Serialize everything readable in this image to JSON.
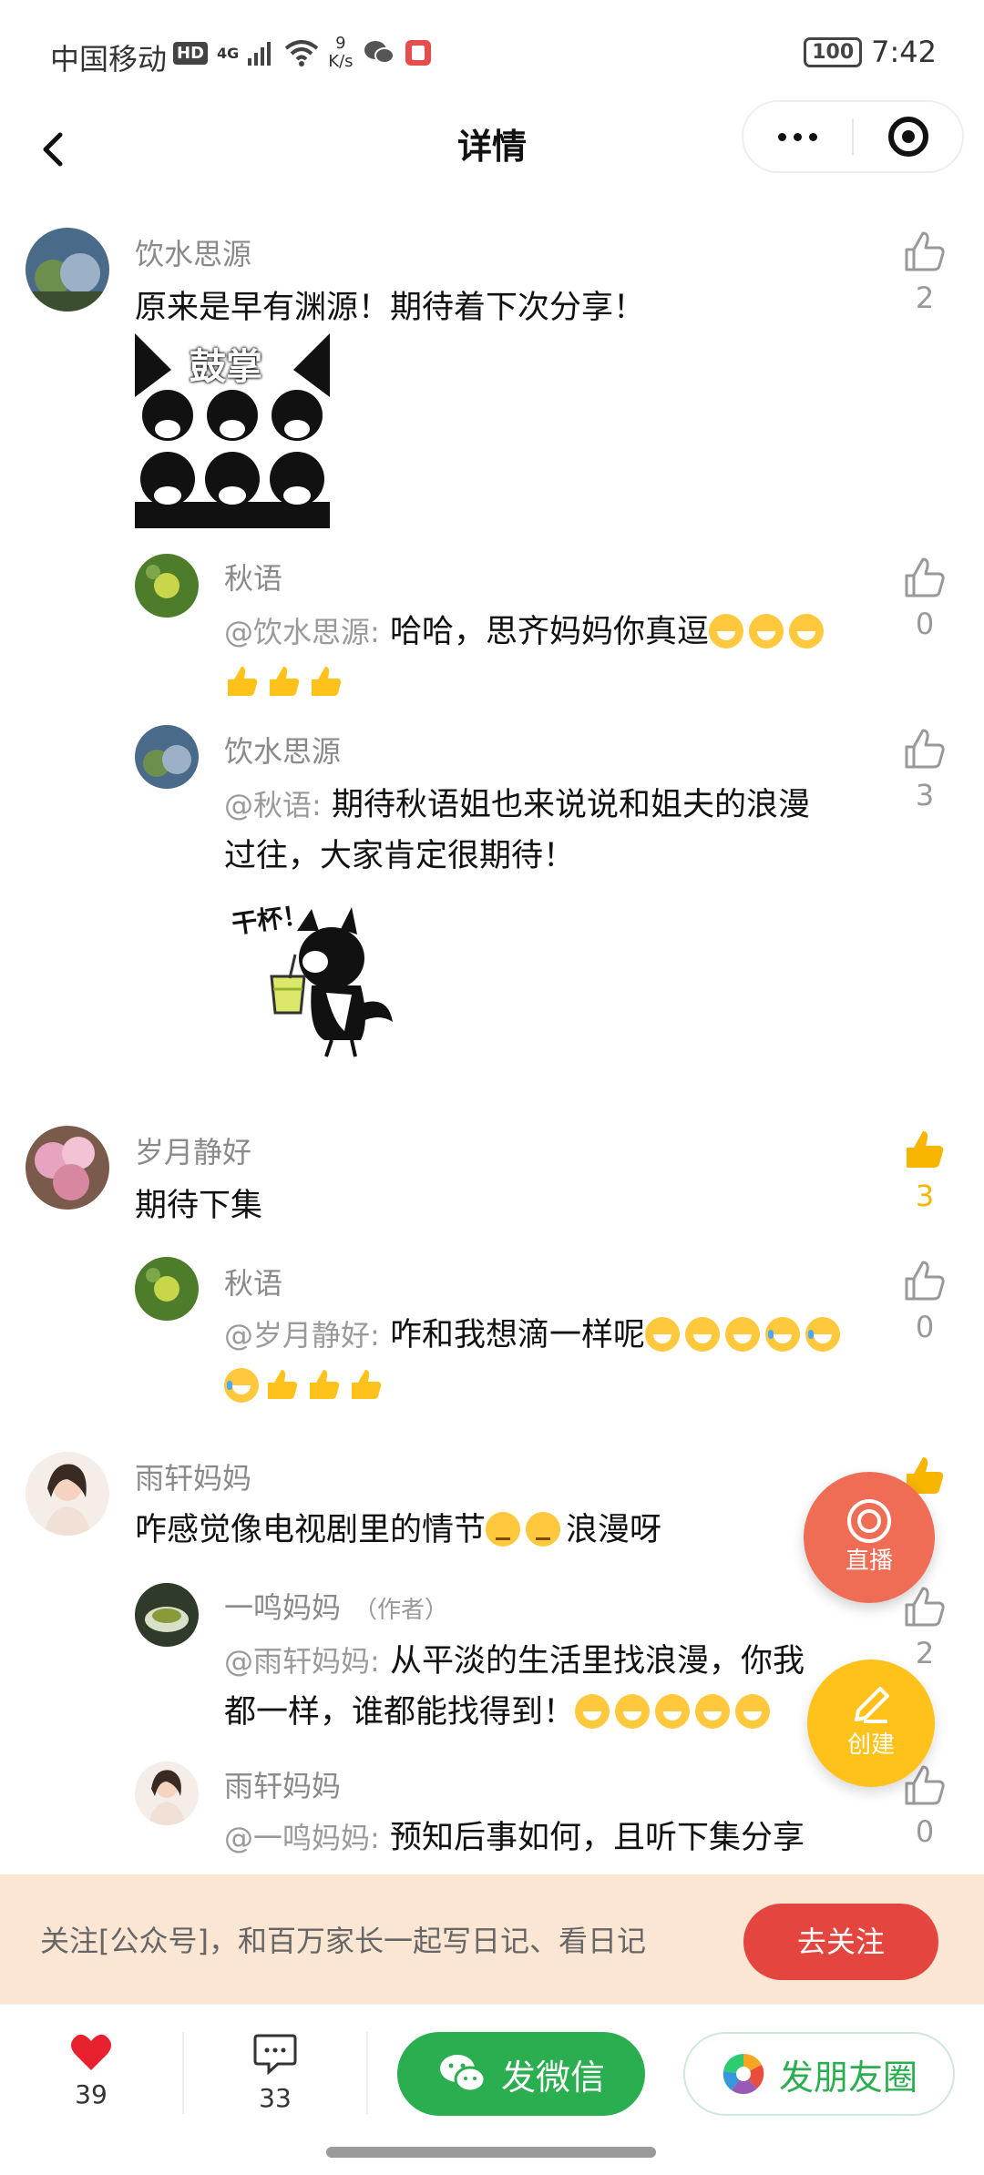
{
  "status_bar": {
    "carrier": "中国移动",
    "hd": "HD",
    "network": "4G",
    "speed_value": "9",
    "speed_unit": "K/s",
    "battery": "100",
    "time": "7:42"
  },
  "nav": {
    "title": "详情"
  },
  "comments": [
    {
      "user": "饮水思源",
      "text": "原来是早有渊源！期待着下次分享！",
      "likes": "2",
      "sticker_text": "鼓掌",
      "replies": [
        {
          "user": "秋语",
          "mention": "@饮水思源:",
          "text": "哈哈，思齐妈妈你真逗",
          "likes": "0"
        },
        {
          "user": "饮水思源",
          "mention": "@秋语:",
          "text_line1": "期待秋语姐也来说说和姐夫的浪漫",
          "text_line2": "过往，大家肯定很期待！",
          "likes": "3",
          "sticker_text": "干杯！"
        }
      ]
    },
    {
      "user": "岁月静好",
      "text": "期待下集",
      "likes": "3",
      "replies": [
        {
          "user": "秋语",
          "mention": "@岁月静好:",
          "text": "咋和我想滴一样呢",
          "likes": "0"
        }
      ]
    },
    {
      "user": "雨轩妈妈",
      "text_a": "咋感觉像电视剧里的情节",
      "text_b": "浪漫呀",
      "replies": [
        {
          "user": "一鸣妈妈",
          "author_tag": "（作者）",
          "mention": "@雨轩妈妈:",
          "text_line1": "从平淡的生活里找浪漫，你我",
          "text_line2": "都一样，谁都能找得到！",
          "likes": "2"
        },
        {
          "user": "雨轩妈妈",
          "mention": "@一鸣妈妈:",
          "text": "预知后事如何，且听下集分享",
          "likes": "0"
        }
      ]
    }
  ],
  "fab": {
    "live": "直播",
    "create": "创建"
  },
  "follow_banner": {
    "text": "关注[公众号]，和百万家长一起写日记、看日记",
    "button": "去关注"
  },
  "bottom_bar": {
    "likes": "39",
    "comments": "33",
    "wechat": "发微信",
    "moments": "发朋友圈"
  },
  "colors": {
    "accent_red": "#e5453f",
    "like_active": "#f7b500",
    "wechat_green": "#2aae4f",
    "live_orange": "#ef6c55",
    "create_yellow": "#ffc21a"
  }
}
